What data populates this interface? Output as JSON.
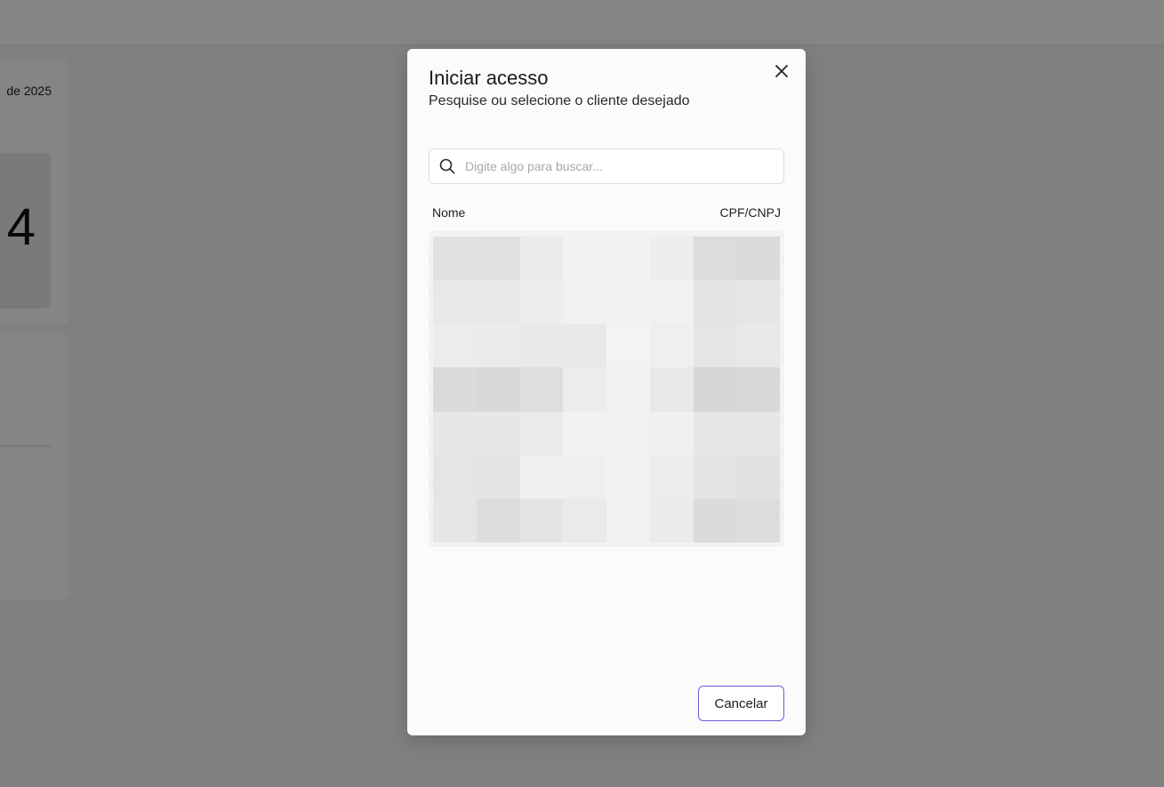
{
  "background": {
    "card_date_text": "de 2025",
    "metric_value": "4"
  },
  "modal": {
    "title": "Iniciar acesso",
    "subtitle": "Pesquise ou selecione o cliente desejado",
    "close_icon": "close-icon",
    "search": {
      "placeholder": "Digite algo para buscar...",
      "value": "",
      "icon": "search-icon"
    },
    "columns": {
      "name": "Nome",
      "document": "CPF/CNPJ"
    },
    "cancel_label": "Cancelar"
  },
  "colors": {
    "overlay": "rgba(0,0,0,0.48)",
    "accent_border": "#6a5ad8",
    "modal_bg": "#fbfbfb"
  }
}
